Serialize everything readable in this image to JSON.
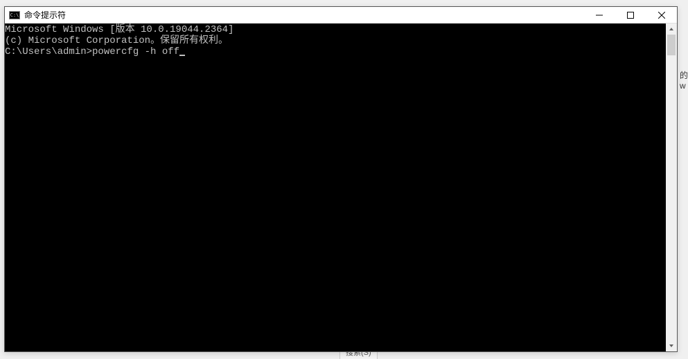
{
  "titlebar": {
    "icon_glyph": "C:\\",
    "title": "命令提示符"
  },
  "console": {
    "line1": "Microsoft Windows [版本 10.0.19044.2364]",
    "line2": "(c) Microsoft Corporation。保留所有权利。",
    "blank": "",
    "prompt": "C:\\Users\\admin>",
    "command": "powercfg -h off"
  },
  "background": {
    "right_char1": "的",
    "right_char2": "w",
    "bottom_hint": "搜索(S)"
  }
}
